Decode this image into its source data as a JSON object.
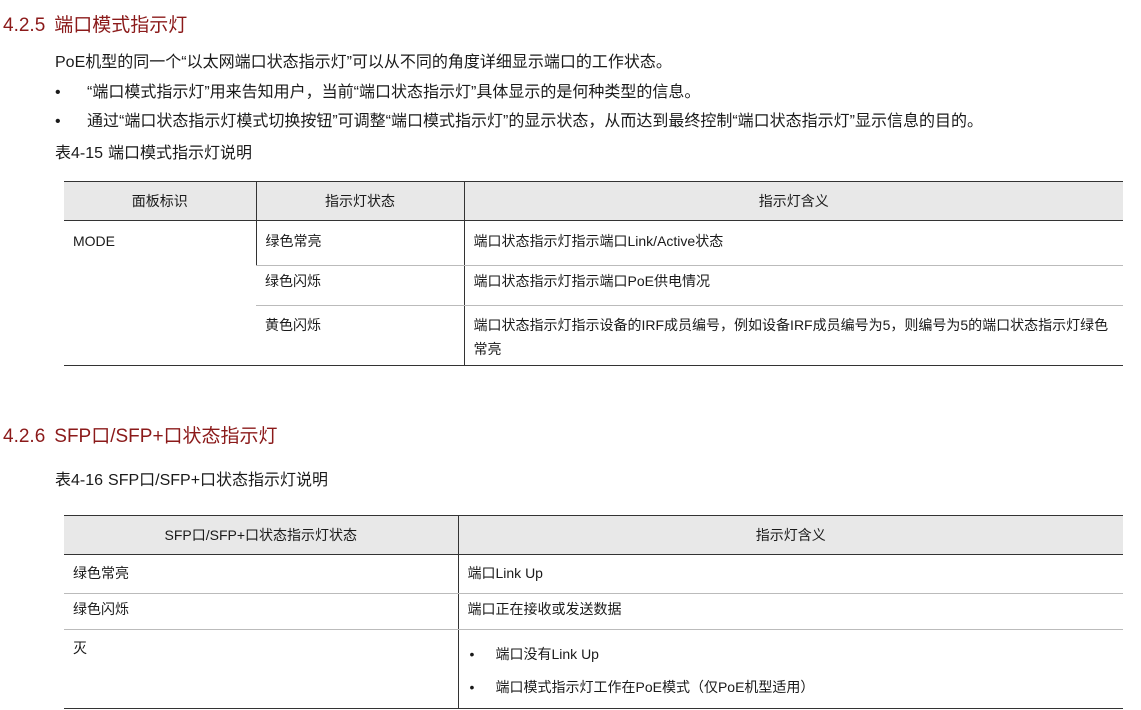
{
  "section1": {
    "number": "4.2.5",
    "title": "端口模式指示灯",
    "intro": "PoE机型的同一个“以太网端口状态指示灯”可以从不同的角度详细显示端口的工作状态。",
    "bullets": [
      "“端口模式指示灯”用来告知用户，当前“端口状态指示灯”具体显示的是何种类型的信息。",
      "通过“端口状态指示灯模式切换按钮”可调整“端口模式指示灯”的显示状态，从而达到最终控制“端口状态指示灯”显示信息的目的。"
    ],
    "table_caption_num": "表4-15",
    "table_caption_text": "端口模式指示灯说明",
    "table": {
      "headers": [
        "面板标识",
        "指示灯状态",
        "指示灯含义"
      ],
      "panel_id": "MODE",
      "rows": [
        {
          "state": "绿色常亮",
          "meaning": "端口状态指示灯指示端口Link/Active状态"
        },
        {
          "state": "绿色闪烁",
          "meaning": "端口状态指示灯指示端口PoE供电情况"
        },
        {
          "state": "黄色闪烁",
          "meaning": "端口状态指示灯指示设备的IRF成员编号，例如设备IRF成员编号为5，则编号为5的端口状态指示灯绿色常亮"
        }
      ]
    }
  },
  "section2": {
    "number": "4.2.6",
    "title": "SFP口/SFP+口状态指示灯",
    "table_caption_num": "表4-16",
    "table_caption_text": "SFP口/SFP+口状态指示灯说明",
    "table": {
      "headers": [
        "SFP口/SFP+口状态指示灯状态",
        "指示灯含义"
      ],
      "rows": [
        {
          "state": "绿色常亮",
          "meaning": "端口Link Up"
        },
        {
          "state": "绿色闪烁",
          "meaning": "端口正在接收或发送数据"
        }
      ],
      "off_row": {
        "state": "灭",
        "meanings": [
          "端口没有Link Up",
          "端口模式指示灯工作在PoE模式（仅PoE机型适用）"
        ]
      }
    }
  },
  "colors": {
    "heading": "#8b1a1a",
    "header_bg": "#e8e8e8"
  }
}
